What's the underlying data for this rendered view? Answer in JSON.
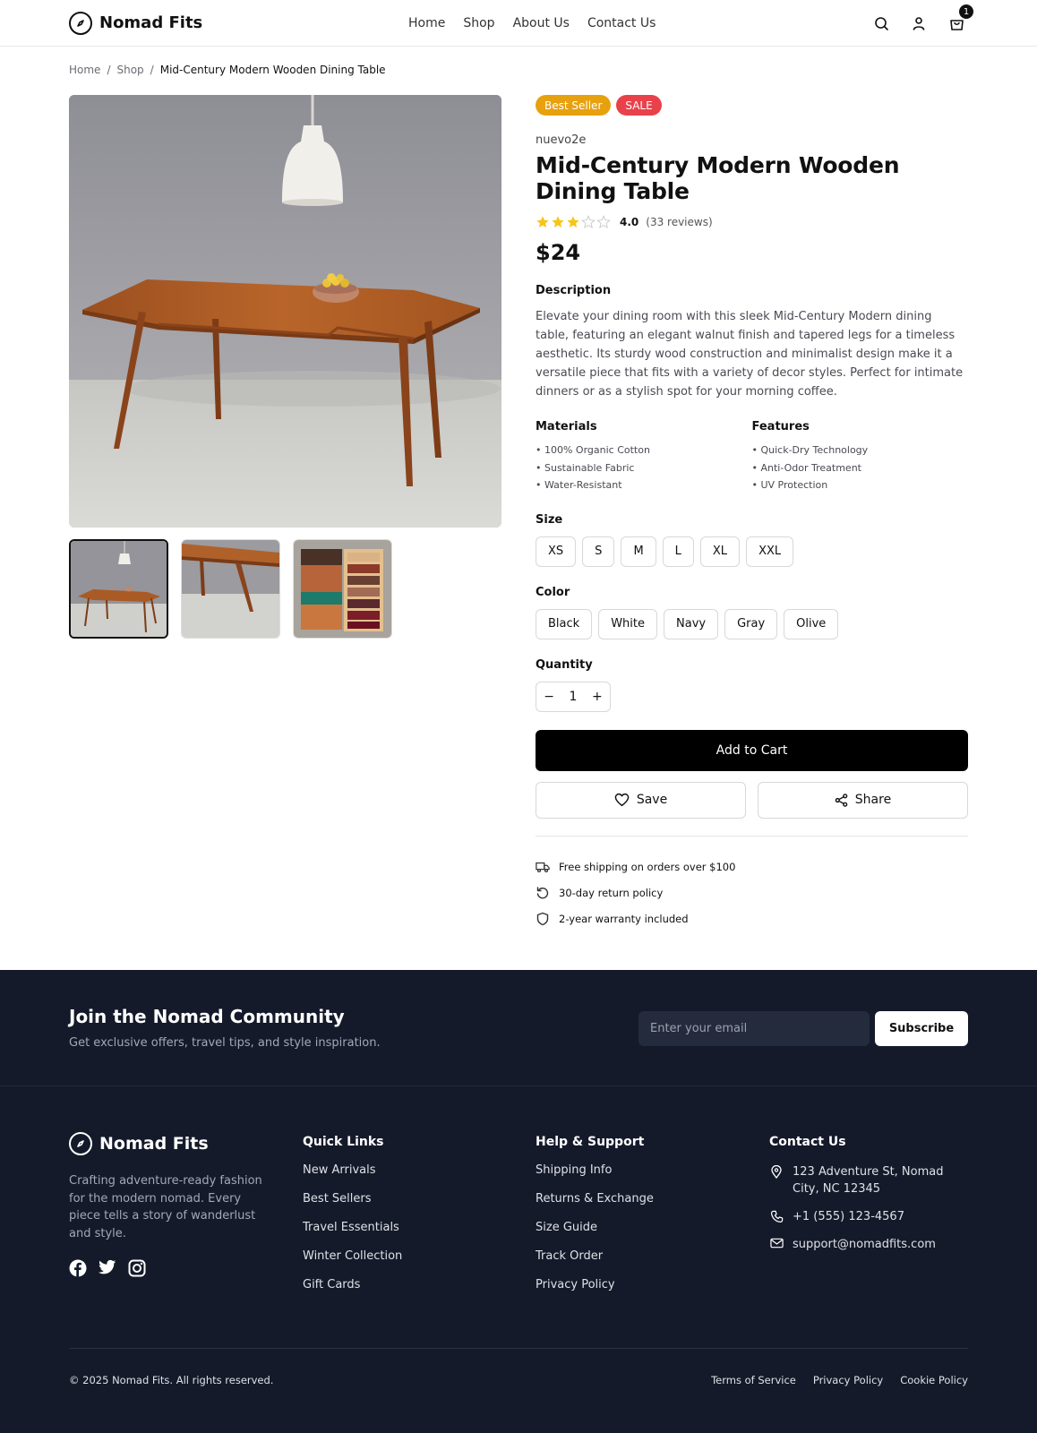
{
  "brand": {
    "name": "Nomad Fits"
  },
  "nav": {
    "items": [
      "Home",
      "Shop",
      "About Us",
      "Contact Us"
    ]
  },
  "header_icons": {
    "search": "search-icon",
    "account": "user-icon",
    "cart": "cart-icon",
    "cart_count": "1"
  },
  "breadcrumb": {
    "items": [
      "Home",
      "Shop"
    ],
    "current": "Mid-Century Modern Wooden Dining Table"
  },
  "gallery": {
    "main_image": "walnut dining table with pendant lamp",
    "thumbnails": [
      "table-front",
      "table-leg-detail",
      "wood-swatches"
    ],
    "active_thumbnail": 0
  },
  "product": {
    "badges": [
      "Best Seller",
      "SALE"
    ],
    "vendor": "nuevo2e",
    "title": "Mid-Century Modern Wooden Dining Table",
    "rating": {
      "stars_filled": 3,
      "stars_total": 5,
      "value": "4.0",
      "reviews": "(33 reviews)"
    },
    "price": "$24",
    "description_label": "Description",
    "description": "Elevate your dining room with this sleek Mid-Century Modern dining table, featuring an elegant walnut finish and tapered legs for a timeless aesthetic. Its sturdy wood construction and minimalist design make it a versatile piece that fits with a variety of decor styles. Perfect for intimate dinners or as a stylish spot for your morning coffee.",
    "materials_label": "Materials",
    "materials": [
      "• 100% Organic Cotton",
      "• Sustainable Fabric",
      "• Water-Resistant"
    ],
    "features_label": "Features",
    "features": [
      "• Quick-Dry Technology",
      "• Anti-Odor Treatment",
      "• UV Protection"
    ],
    "size_label": "Size",
    "sizes": [
      "XS",
      "S",
      "M",
      "L",
      "XL",
      "XXL"
    ],
    "color_label": "Color",
    "colors": [
      "Black",
      "White",
      "Navy",
      "Gray",
      "Olive"
    ],
    "quantity_label": "Quantity",
    "quantity": {
      "minus": "−",
      "value": "1",
      "plus": "+"
    },
    "add_to_cart": "Add to Cart",
    "save": "Save",
    "share": "Share",
    "perks": [
      "Free shipping on orders over $100",
      "30-day return policy",
      "2-year warranty included"
    ]
  },
  "newsletter": {
    "title": "Join the Nomad Community",
    "subtitle": "Get exclusive offers, travel tips, and style inspiration.",
    "placeholder": "Enter your email",
    "button": "Subscribe"
  },
  "footer": {
    "about": "Crafting adventure-ready fashion for the modern nomad. Every piece tells a story of wanderlust and style.",
    "social": [
      "facebook-icon",
      "twitter-icon",
      "instagram-icon"
    ],
    "quick_links": {
      "title": "Quick Links",
      "items": [
        "New Arrivals",
        "Best Sellers",
        "Travel Essentials",
        "Winter Collection",
        "Gift Cards"
      ]
    },
    "help": {
      "title": "Help & Support",
      "items": [
        "Shipping Info",
        "Returns & Exchange",
        "Size Guide",
        "Track Order",
        "Privacy Policy"
      ]
    },
    "contact": {
      "title": "Contact Us",
      "address": "123 Adventure St, Nomad City, NC 12345",
      "phone": "+1 (555) 123-4567",
      "email": "support@nomadfits.com"
    },
    "copyright": "© 2025 Nomad Fits. All rights reserved.",
    "legal": [
      "Terms of Service",
      "Privacy Policy",
      "Cookie Policy"
    ]
  },
  "colors": {
    "badge_best_seller": "#e7a10f",
    "badge_sale": "#e9414a",
    "star": "#f5c518",
    "footer_bg": "#141a2a",
    "primary_button": "#000000"
  }
}
